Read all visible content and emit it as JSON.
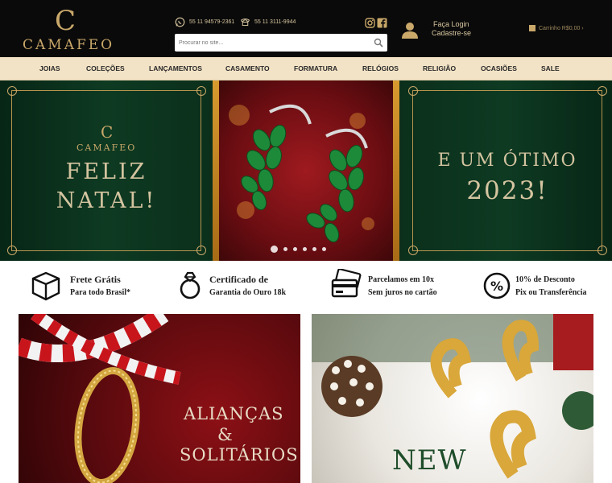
{
  "brand": {
    "monogram": "C",
    "name": "CAMAFEO"
  },
  "header": {
    "phones": [
      "55 11 94579-2361",
      "55 11 3111-9944"
    ],
    "search_placeholder": "Procurar no site...",
    "login_label": "Faça Login",
    "signup_label": "Cadastre-se",
    "cart_label": "Carrinho R$0,00 ›"
  },
  "nav": [
    "JOIAS",
    "COLEÇÕES",
    "LANÇAMENTOS",
    "CASAMENTO",
    "FORMATURA",
    "RELÓGIOS",
    "RELIGIÃO",
    "OCASIÕES",
    "SALE"
  ],
  "hero": {
    "logo_c": "C",
    "logo_text": "CAMAFEO",
    "left_line1": "FELIZ",
    "left_line2": "NATAL!",
    "right_line1": "E UM ÓTIMO",
    "right_line2": "2023!",
    "slides": 6,
    "active_slide": 1
  },
  "features": [
    {
      "title": "Frete Grátis",
      "sub": "Para todo Brasil*",
      "icon": "box-icon"
    },
    {
      "title": "Certificado de",
      "sub": "Garantia do Ouro 18k",
      "icon": "ring-icon"
    },
    {
      "title": "Parcelamos em 10x",
      "sub": "Sem juros no cartão",
      "icon": "credit-card-icon"
    },
    {
      "title": "10% de Desconto",
      "sub": "Pix ou Transferência",
      "icon": "percent-icon"
    }
  ],
  "banners": {
    "left_line1": "ALIANÇAS",
    "left_line2": "&",
    "left_line3": "SOLITÁRIOS",
    "right_text": "NEW"
  },
  "colors": {
    "header_bg": "#0a0a0a",
    "gold": "#c9a86a",
    "nav_bg": "#f3e3c6",
    "hero_green": "#0d3320",
    "hero_red": "#9e1a1f"
  }
}
